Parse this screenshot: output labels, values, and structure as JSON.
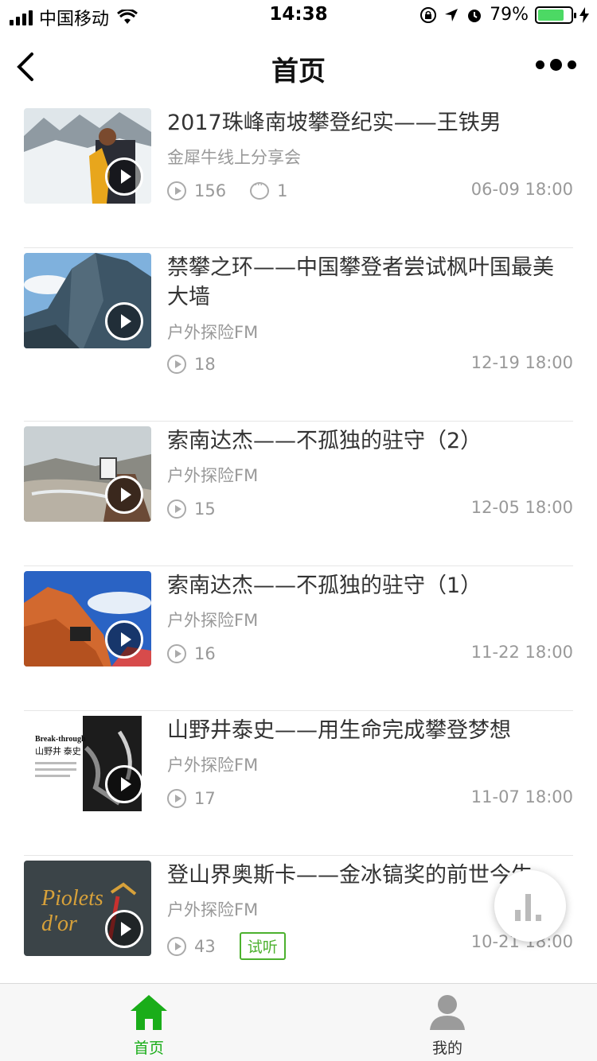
{
  "status_bar": {
    "carrier": "中国移动",
    "time": "14:38",
    "battery": "79%",
    "battery_level": 0.79
  },
  "nav": {
    "title": "首页"
  },
  "items": [
    {
      "title": "2017珠峰南坡攀登纪实——王铁男",
      "source": "金犀牛线上分享会",
      "plays": "156",
      "comments": "1",
      "time": "06-09 18:00"
    },
    {
      "title": "禁攀之环——中国攀登者尝试枫叶国最美大墙",
      "source": "户外探险FM",
      "plays": "18",
      "time": "12-19 18:00"
    },
    {
      "title": "索南达杰——不孤独的驻守（2）",
      "source": "户外探险FM",
      "plays": "15",
      "time": "12-05 18:00"
    },
    {
      "title": "索南达杰——不孤独的驻守（1）",
      "source": "户外探险FM",
      "plays": "16",
      "time": "11-22 18:00"
    },
    {
      "title": "山野井泰史——用生命完成攀登梦想",
      "source": "户外探险FM",
      "plays": "17",
      "time": "11-07 18:00",
      "thumb_text": {
        "brand": "Break-through",
        "name": "山野井 泰史"
      }
    },
    {
      "title": "登山界奥斯卡——金冰镐奖的前世今生",
      "source": "户外探险FM",
      "plays": "43",
      "tag": "试听",
      "time": "10-21 18:00",
      "thumb_text": {
        "line1": "Piolets",
        "line2": "d'or"
      }
    }
  ],
  "tabbar": {
    "home": "首页",
    "mine": "我的"
  },
  "colors": {
    "accent": "#4cb12e",
    "muted": "#999999",
    "title": "#333333"
  }
}
